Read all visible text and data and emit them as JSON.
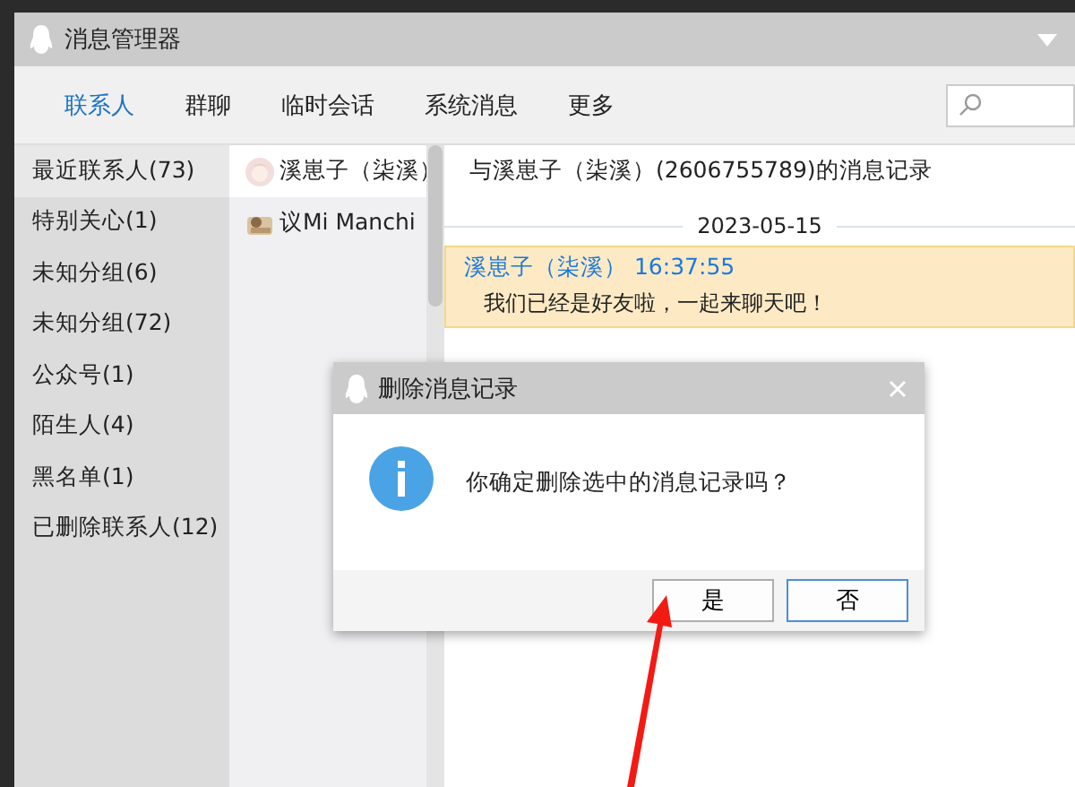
{
  "window": {
    "title": "消息管理器"
  },
  "tabs": [
    {
      "label": "联系人",
      "selected": true
    },
    {
      "label": "群聊",
      "selected": false
    },
    {
      "label": "临时会话",
      "selected": false
    },
    {
      "label": "系统消息",
      "selected": false
    },
    {
      "label": "更多",
      "selected": false
    }
  ],
  "groups": [
    {
      "label": "最近联系人(73)",
      "selected": true
    },
    {
      "label": "特别关心(1)",
      "selected": false
    },
    {
      "label": "未知分组(6)",
      "selected": false
    },
    {
      "label": "未知分组(72)",
      "selected": false
    },
    {
      "label": "公众号(1)",
      "selected": false
    },
    {
      "label": "陌生人(4)",
      "selected": false
    },
    {
      "label": "黑名单(1)",
      "selected": false
    },
    {
      "label": "已删除联系人(12)",
      "selected": false
    }
  ],
  "contacts": [
    {
      "name": "溪崽子（柒溪）",
      "selected": true
    },
    {
      "name": "议Mi Manchi",
      "selected": false
    }
  ],
  "record": {
    "title": "与溪崽子（柒溪）(2606755789)的消息记录",
    "date": "2023-05-15",
    "messages": [
      {
        "sender": "溪崽子（柒溪）",
        "time": "16:37:55",
        "text": "我们已经是好友啦，一起来聊天吧！"
      }
    ]
  },
  "dialog": {
    "title": "删除消息记录",
    "message": "你确定删除选中的消息记录吗？",
    "buttons": [
      {
        "label": "是",
        "default": false
      },
      {
        "label": "否",
        "default": true
      }
    ]
  }
}
